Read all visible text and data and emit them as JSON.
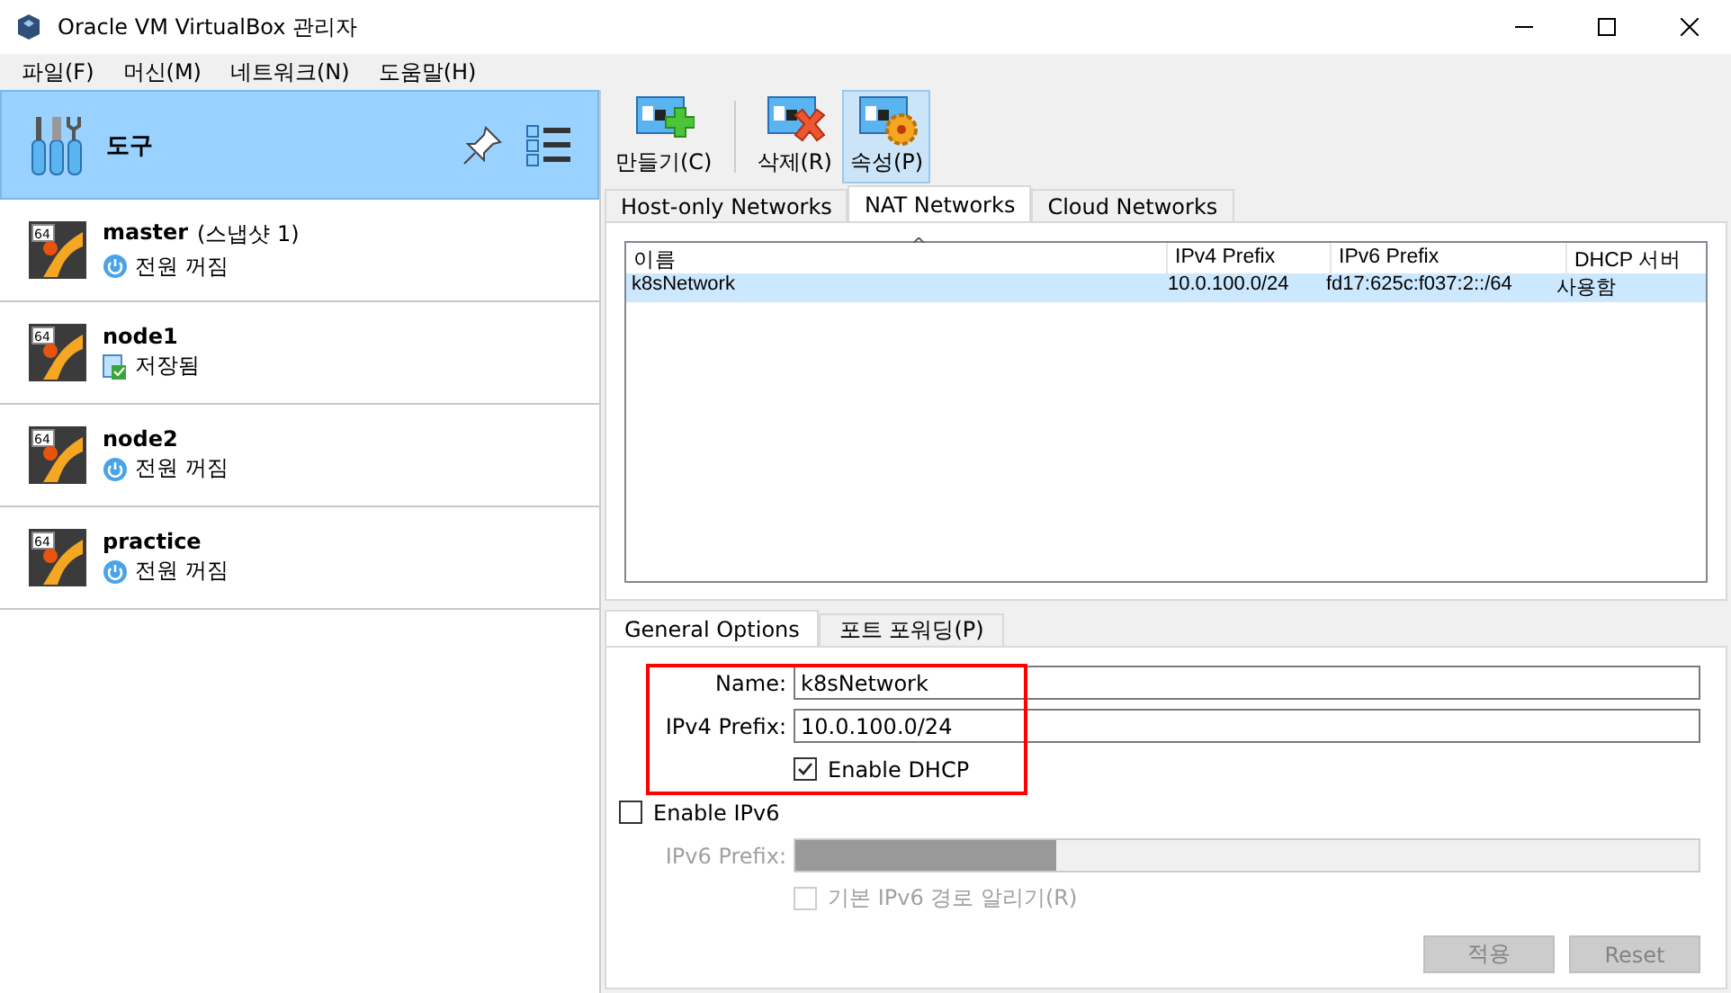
{
  "window": {
    "title": "Oracle VM VirtualBox 관리자"
  },
  "menu": [
    "파일(F)",
    "머신(M)",
    "네트워크(N)",
    "도움말(H)"
  ],
  "tools": {
    "label": "도구"
  },
  "machines": [
    {
      "name": "master",
      "snapshot": "(스냅샷 1)",
      "status": "전원 꺼짐",
      "kind": "off",
      "os_badge": "64"
    },
    {
      "name": "node1",
      "status": "저장됨",
      "kind": "saved",
      "os_badge": "64"
    },
    {
      "name": "node2",
      "status": "전원 꺼짐",
      "kind": "off",
      "os_badge": "64"
    },
    {
      "name": "practice",
      "status": "전원 꺼짐",
      "kind": "off",
      "os_badge": "64"
    }
  ],
  "toolbar": [
    {
      "label": "만들기(C)",
      "kind": "create",
      "selected": false
    },
    {
      "label": "삭제(R)",
      "kind": "remove",
      "selected": false
    },
    {
      "label": "속성(P)",
      "kind": "properties",
      "selected": true
    }
  ],
  "tabs": [
    {
      "label": "Host-only Networks",
      "selected": false
    },
    {
      "label": "NAT Networks",
      "selected": true
    },
    {
      "label": "Cloud Networks",
      "selected": false
    }
  ],
  "table": {
    "columns": [
      "이름",
      "IPv4 Prefix",
      "IPv6 Prefix",
      "DHCP 서버"
    ],
    "sort_mark": "^",
    "rows": [
      {
        "cells": [
          "k8sNetwork",
          "10.0.100.0/24",
          "fd17:625c:f037:2::/64",
          "사용함"
        ],
        "selected": true
      }
    ]
  },
  "detail_tabs": [
    {
      "label": "General Options",
      "selected": true
    },
    {
      "label": "포트 포워딩(P)",
      "selected": false
    }
  ],
  "form": {
    "name_label": "Name:",
    "name_value": "k8sNetwork",
    "ipv4_label": "IPv4 Prefix:",
    "ipv4_value": "10.0.100.0/24",
    "dhcp": {
      "label": "Enable DHCP",
      "checked": true
    },
    "ipv6": {
      "label": "Enable IPv6",
      "checked": false
    },
    "ipv6_prefix_label": "IPv6 Prefix:",
    "advertise": {
      "label": "기본 IPv6 경로 알리기(R)",
      "checked": false,
      "disabled": true
    }
  },
  "buttons": [
    {
      "label": "적용",
      "disabled": true
    },
    {
      "label": "Reset",
      "disabled": true
    }
  ]
}
